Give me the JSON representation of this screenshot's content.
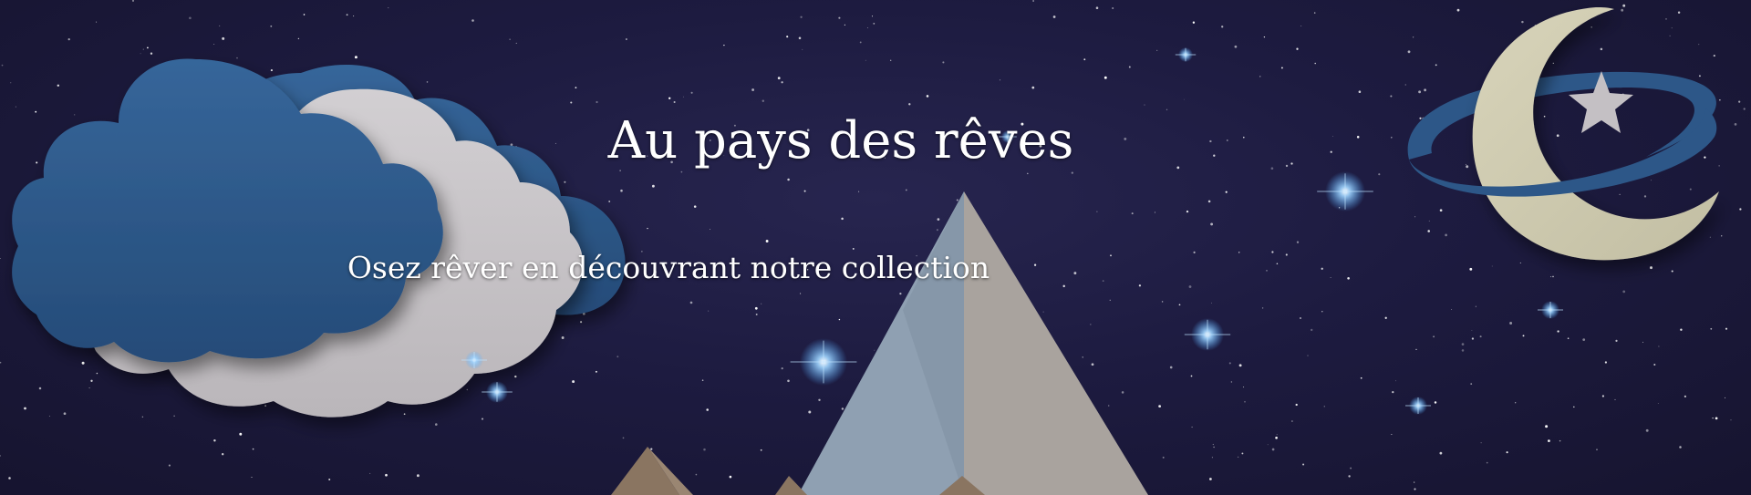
{
  "banner": {
    "title": "Au pays des rêves",
    "subtitle": "Osez rêver en découvrant notre collection"
  },
  "colors": {
    "sky": "#1d1b40",
    "cloud_blue": "#2f5a8c",
    "cloud_grey": "#c9c6c9",
    "moon": "#cfcbb0",
    "ring": "#2d5788",
    "mountain_light": "#8fa0b2",
    "mountain_grey": "#a9a39e",
    "mountain_brown": "#8a7561"
  }
}
